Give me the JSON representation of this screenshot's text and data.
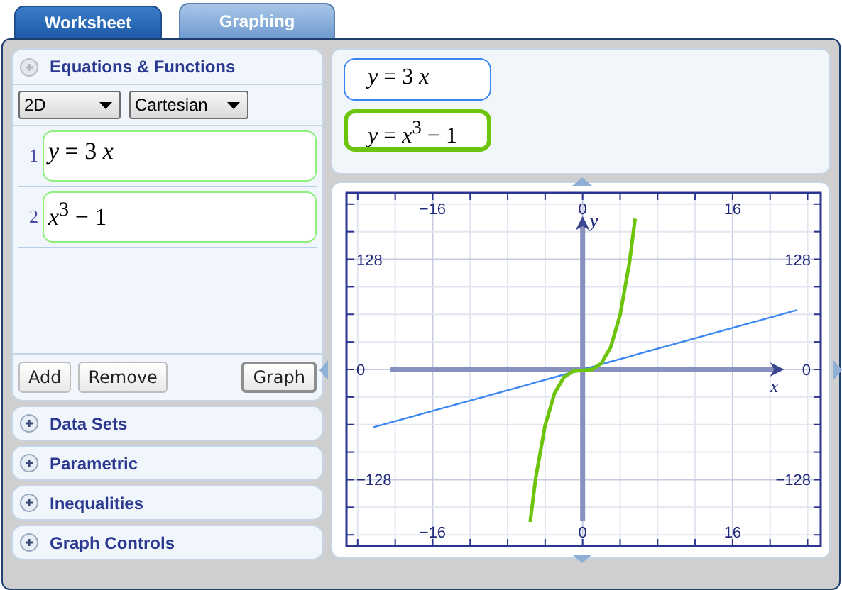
{
  "tabs": [
    {
      "label": "Worksheet",
      "selected": false
    },
    {
      "label": "Graphing",
      "selected": true
    }
  ],
  "sidebar": {
    "sections": [
      {
        "title": "Equations & Functions",
        "expanded": true
      },
      {
        "title": "Data Sets",
        "expanded": false
      },
      {
        "title": "Parametric",
        "expanded": false
      },
      {
        "title": "Inequalities",
        "expanded": false
      },
      {
        "title": "Graph Controls",
        "expanded": false
      }
    ],
    "dimension_select": "2D",
    "coordinate_select": "Cartesian",
    "equations": [
      {
        "number": "1",
        "text": "*y* = 3 *x*"
      },
      {
        "number": "2",
        "text": "*x*$^{3}$ − 1"
      }
    ],
    "buttons": [
      {
        "label": "Add",
        "default": false
      },
      {
        "label": "Remove",
        "default": false
      },
      {
        "label": "Graph",
        "default": true
      }
    ]
  },
  "legend": [
    {
      "text": "*y* = 3 *x*",
      "color": "#3a86f2",
      "selected": false
    },
    {
      "text": "*y* = *x*$^{3}$ − 1",
      "color": "#6cc40c",
      "selected": true
    }
  ],
  "graph": {
    "chart_data": {
      "type": "line",
      "xlabel": "x",
      "ylabel": "y",
      "x": [
        -22.3,
        -5.6,
        -5,
        -4,
        -3,
        -2,
        -1,
        0,
        1,
        2,
        3,
        4,
        5,
        5.6,
        22.9
      ],
      "series": [
        {
          "color": "#3a86f2",
          "values": [
            -67,
            -17,
            -15,
            -12,
            -9,
            -6,
            -3,
            0,
            3,
            6,
            9,
            12,
            15,
            17,
            69
          ]
        },
        {
          "color": "#6cc40c",
          "values": [
            null,
            -177,
            -126,
            -65,
            -28,
            -9,
            -2,
            -1,
            0,
            7,
            26,
            63,
            124,
            175,
            null
          ]
        }
      ],
      "xlim": [
        -25.2,
        25.4
      ],
      "ylim": [
        -205,
        205
      ],
      "xticks": [
        -16,
        0,
        16
      ],
      "yticks": [
        -128,
        0,
        128
      ],
      "grid": true
    },
    "bottom_tick_labels": [
      "−16",
      "0",
      "16"
    ],
    "right_tick_labels": [
      "128",
      "0",
      "−128"
    ]
  }
}
